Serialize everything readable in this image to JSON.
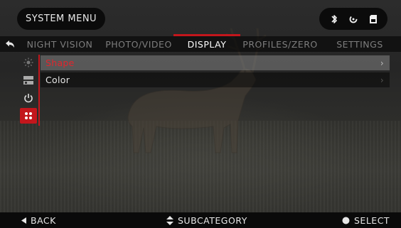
{
  "header": {
    "menu_title": "SYSTEM MENU",
    "status_icons": [
      "bluetooth-icon",
      "connection-icon",
      "sd-card-icon"
    ]
  },
  "tabs": [
    {
      "label": "NIGHT VISION",
      "active": false
    },
    {
      "label": "PHOTO/VIDEO",
      "active": false
    },
    {
      "label": "DISPLAY",
      "active": true
    },
    {
      "label": "PROFILES/ZERO",
      "active": false
    },
    {
      "label": "SETTINGS",
      "active": false
    }
  ],
  "subcategories": [
    {
      "icon": "brightness-icon",
      "active": false
    },
    {
      "icon": "layout-icon",
      "active": false
    },
    {
      "icon": "power-icon",
      "active": false
    },
    {
      "icon": "dots-grid-icon",
      "active": true
    }
  ],
  "menu_items": [
    {
      "label": "Shape",
      "selected": true
    },
    {
      "label": "Color",
      "selected": false
    }
  ],
  "footer": {
    "back_label": "BACK",
    "subcategory_label": "SUBCATEGORY",
    "select_label": "SELECT"
  },
  "colors": {
    "accent": "#c3161c",
    "selected_text": "#e0262d"
  }
}
